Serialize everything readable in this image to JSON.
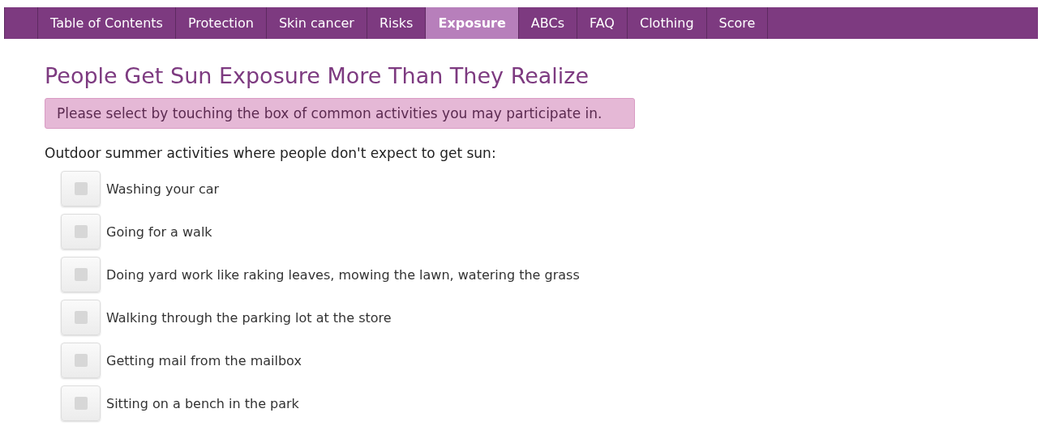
{
  "nav": [
    {
      "label": "Table of Contents",
      "selected": false
    },
    {
      "label": "Protection",
      "selected": false
    },
    {
      "label": "Skin cancer",
      "selected": false
    },
    {
      "label": "Risks",
      "selected": false
    },
    {
      "label": "Exposure",
      "selected": true
    },
    {
      "label": "ABCs",
      "selected": false
    },
    {
      "label": "FAQ",
      "selected": false
    },
    {
      "label": "Clothing",
      "selected": false
    },
    {
      "label": "Score",
      "selected": false
    }
  ],
  "title": "People Get Sun Exposure More Than They Realize",
  "notice": "Please select by touching the box of common activities you may participate in.",
  "section": "Outdoor summer activities where people don't expect to get sun:",
  "activities": [
    {
      "label": "Washing your car",
      "checked": false
    },
    {
      "label": "Going for a walk",
      "checked": false
    },
    {
      "label": "Doing yard work like raking leaves, mowing the lawn, watering the grass",
      "checked": false
    },
    {
      "label": "Walking through the parking lot at the store",
      "checked": false
    },
    {
      "label": "Getting mail from the mailbox",
      "checked": false
    },
    {
      "label": "Sitting on a bench in the park",
      "checked": false
    }
  ]
}
